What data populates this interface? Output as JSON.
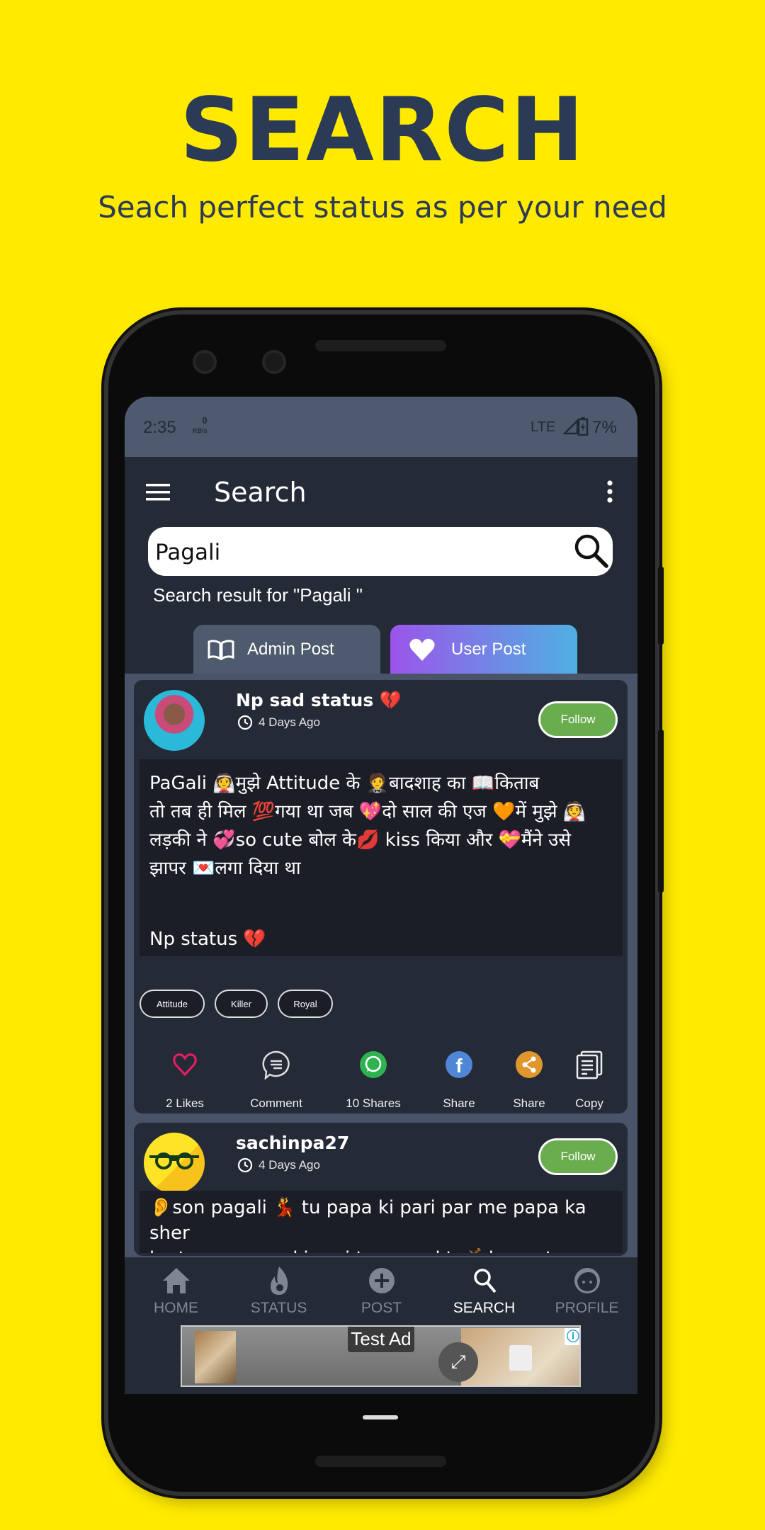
{
  "hero": {
    "title": "SEARCH",
    "subtitle": "Seach perfect status as per your need"
  },
  "status_bar": {
    "time": "2:35",
    "net_speed": "0",
    "net_unit": "KB/s",
    "network": "LTE",
    "battery": "7%"
  },
  "app_bar": {
    "title": "Search",
    "menu_icon": "hamburger-icon",
    "more_icon": "more-vert-icon"
  },
  "search": {
    "value": "Pagali",
    "placeholder": "",
    "result_text": "Search result for \"Pagali \""
  },
  "tabs": [
    {
      "label": "Admin Post",
      "icon": "book-icon",
      "active": false
    },
    {
      "label": "User Post",
      "icon": "heart-icon",
      "active": true
    }
  ],
  "posts": [
    {
      "username": "Np sad status 💔",
      "time": "4 Days Ago",
      "follow_label": "Follow",
      "text_lines": [
        "PaGali 👰मुझे Attitude के 🤵बादशाह का 📖किताब",
        "तो तब ही मिल 💯गया था जब 💖दो साल की एज 🧡में  मुझे 👰",
        "लड़की ने  💞so cute  बोल के💋 kiss किया और 💝मैंने उसे",
        "झापर 💌लगा दिया था",
        "",
        "",
        "Np status 💔"
      ],
      "tags": [
        "Attitude",
        "Killer",
        "Royal"
      ],
      "actions": [
        {
          "label": "2 Likes",
          "icon": "heart-outline-icon"
        },
        {
          "label": "Comment",
          "icon": "comment-icon"
        },
        {
          "label": "10 Shares",
          "icon": "whatsapp-icon"
        },
        {
          "label": "Share",
          "icon": "facebook-icon"
        },
        {
          "label": "Share",
          "icon": "share-icon"
        },
        {
          "label": "Copy",
          "icon": "copy-icon"
        }
      ]
    },
    {
      "username": "sachinpa27",
      "time": "4 Days Ago",
      "follow_label": "Follow",
      "text_lines": [
        "👂son pagali 💃 tu papa ki pari par me papa ka sher",
        "ho to son papa ki pari tere par kt 🗡️donga to kaha ki"
      ]
    }
  ],
  "bottom_nav": [
    {
      "label": "HOME",
      "icon": "home-icon"
    },
    {
      "label": "STATUS",
      "icon": "fire-icon"
    },
    {
      "label": "POST",
      "icon": "add-circle-icon"
    },
    {
      "label": "SEARCH",
      "icon": "search-icon",
      "active": true
    },
    {
      "label": "PROFILE",
      "icon": "face-icon"
    }
  ],
  "ad": {
    "label": "Test Ad"
  },
  "colors": {
    "background": "#ffea00",
    "title": "#2b3a55",
    "app_bg": "#252a37",
    "follow": "#6aad4f",
    "like": "#e91e63",
    "whatsapp": "#2fb350",
    "facebook": "#4f86d6",
    "share": "#e0952d"
  }
}
